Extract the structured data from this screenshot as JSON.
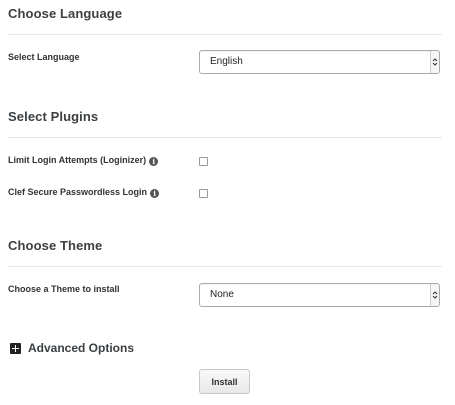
{
  "language_section": {
    "title": "Choose Language",
    "select_label": "Select Language",
    "selected_value": "English"
  },
  "plugins_section": {
    "title": "Select Plugins",
    "plugins": [
      {
        "label": "Limit Login Attempts (Loginizer)",
        "info_icon": "info-circle-icon",
        "checked": false
      },
      {
        "label": "Clef Secure Passwordless Login",
        "info_icon": "info-circle-icon",
        "checked": false
      }
    ]
  },
  "theme_section": {
    "title": "Choose Theme",
    "select_label": "Choose a Theme to install",
    "selected_value": "None"
  },
  "advanced": {
    "label": "Advanced Options",
    "icon": "plus-square-icon"
  },
  "install_button": {
    "label": "Install"
  }
}
